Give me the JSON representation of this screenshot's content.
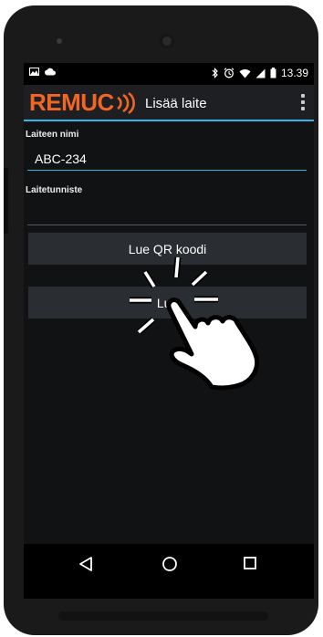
{
  "status_bar": {
    "time": "13.39",
    "left_icons": [
      "image-icon",
      "cloud-icon"
    ],
    "right_icons": [
      "bluetooth-icon",
      "alarm-icon",
      "wifi-icon",
      "signal-icon",
      "battery-icon"
    ]
  },
  "action_bar": {
    "logo_text": "REMUC",
    "title": "Lisää laite",
    "accent_color": "#f26522",
    "divider_color": "#33b5e5"
  },
  "form": {
    "device_name_label": "Laiteen nimi",
    "device_name_value": "ABC-234",
    "device_id_label": "Laitetunniste",
    "device_id_value": ""
  },
  "buttons": {
    "read_qr_label": "Lue QR koodi",
    "read_label": "Lue"
  },
  "navigation": {
    "icons": [
      "back-icon",
      "home-icon",
      "recent-apps-icon"
    ]
  },
  "overlay": {
    "icon": "tap-gesture-hand-icon"
  }
}
